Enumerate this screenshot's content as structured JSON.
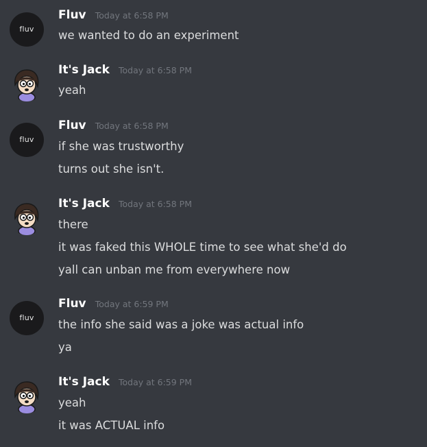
{
  "messages": [
    {
      "author": "Fluv",
      "avatar_text": "fluv",
      "timestamp": "Today at 6:58 PM",
      "lines": [
        "we wanted to do an experiment"
      ]
    },
    {
      "author": "It's Jack",
      "timestamp": "Today at 6:58 PM",
      "lines": [
        "yeah"
      ]
    },
    {
      "author": "Fluv",
      "avatar_text": "fluv",
      "timestamp": "Today at 6:58 PM",
      "lines": [
        "if she was trustworthy",
        "turns out she isn't."
      ]
    },
    {
      "author": "It's Jack",
      "timestamp": "Today at 6:58 PM",
      "lines": [
        "there",
        "it was faked this WHOLE time to see what she'd do",
        "yall can unban me from everywhere now"
      ]
    },
    {
      "author": "Fluv",
      "avatar_text": "fluv",
      "timestamp": "Today at 6:59 PM",
      "lines": [
        "the info she said was a joke was actual info",
        "ya"
      ]
    },
    {
      "author": "It's Jack",
      "timestamp": "Today at 6:59 PM",
      "lines": [
        "yeah",
        "it was ACTUAL info"
      ]
    }
  ],
  "colors": {
    "background": "#36393f",
    "username": "#ffffff",
    "timestamp": "#72767d",
    "message_text": "#dcddde",
    "fluv_avatar_bg": "#1a1a1c",
    "jack_avatar_shirt": "#9b8de0"
  }
}
